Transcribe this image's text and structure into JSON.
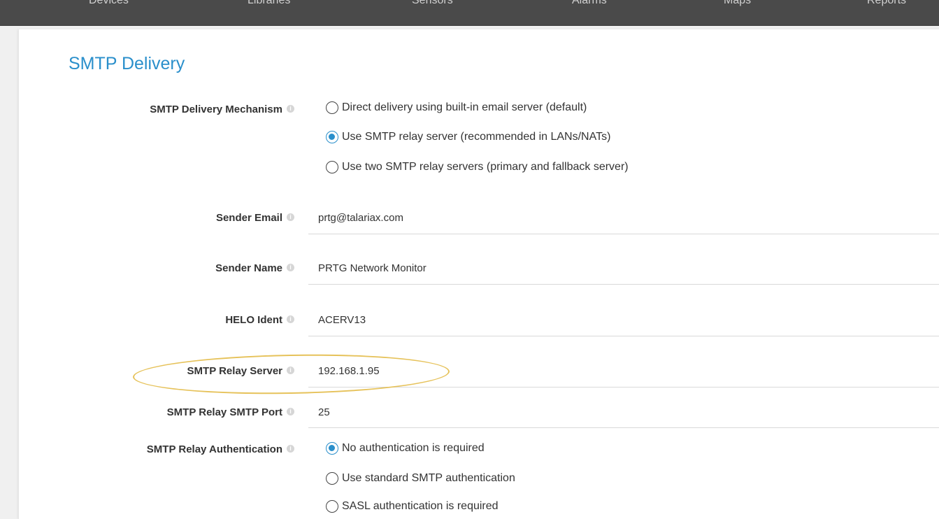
{
  "nav": {
    "items": [
      "Devices",
      "Libraries",
      "Sensors",
      "Alarms",
      "Maps",
      "Reports"
    ]
  },
  "section": {
    "title": "SMTP Delivery"
  },
  "mechanism": {
    "label": "SMTP Delivery Mechanism",
    "options": [
      "Direct delivery using built-in email server (default)",
      "Use SMTP relay server (recommended in LANs/NATs)",
      "Use two SMTP relay servers (primary and fallback server)"
    ],
    "selected_index": 1
  },
  "sender_email": {
    "label": "Sender Email",
    "value": "prtg@talariax.com"
  },
  "sender_name": {
    "label": "Sender Name",
    "value": "PRTG Network Monitor"
  },
  "helo_ident": {
    "label": "HELO Ident",
    "value": "ACERV13"
  },
  "relay_server": {
    "label": "SMTP Relay Server",
    "value": "192.168.1.95"
  },
  "relay_port": {
    "label": "SMTP Relay SMTP Port",
    "value": "25"
  },
  "relay_auth": {
    "label": "SMTP Relay Authentication",
    "options": [
      "No authentication is required",
      "Use standard SMTP authentication",
      "SASL authentication is required"
    ],
    "selected_index": 0
  },
  "info_icon_glyph": "i",
  "colors": {
    "accent": "#2a8fcb",
    "highlight": "#e6c25a",
    "nav_bg": "#4a4a4a"
  }
}
